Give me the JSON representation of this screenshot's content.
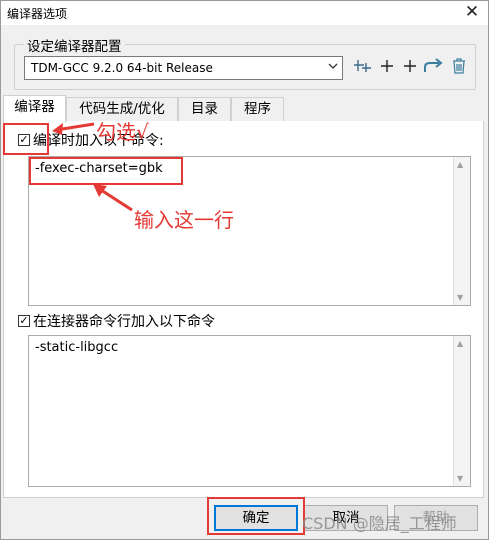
{
  "window": {
    "title": "编译器选项",
    "close_glyph": "✕"
  },
  "config_group": {
    "label": "设定编译器配置",
    "selected_compiler": "TDM-GCC 9.2.0 64-bit Release",
    "toolbar_icons": [
      "add-set-icon",
      "add-icon",
      "add-icon",
      "rename-icon",
      "delete-icon"
    ]
  },
  "tabs": [
    {
      "label": "编译器",
      "active": true
    },
    {
      "label": "代码生成/优化",
      "active": false
    },
    {
      "label": "目录",
      "active": false
    },
    {
      "label": "程序",
      "active": false
    }
  ],
  "compiler_section": {
    "checkbox_label": "编译时加入以下命令:",
    "checked": true,
    "command_text": "-fexec-charset=gbk"
  },
  "linker_section": {
    "checkbox_label": "在连接器命令行加入以下命令",
    "checked": true,
    "command_text": "-static-libgcc"
  },
  "buttons": {
    "ok": "确定",
    "cancel": "取消",
    "help": "帮助"
  },
  "annotations": {
    "check_note": "勾选√",
    "input_note": "输入这一行"
  },
  "watermark": "CSDN @隐居_工程师",
  "colors": {
    "annotation_red": "#e53935",
    "focus_blue": "#0078d7"
  }
}
